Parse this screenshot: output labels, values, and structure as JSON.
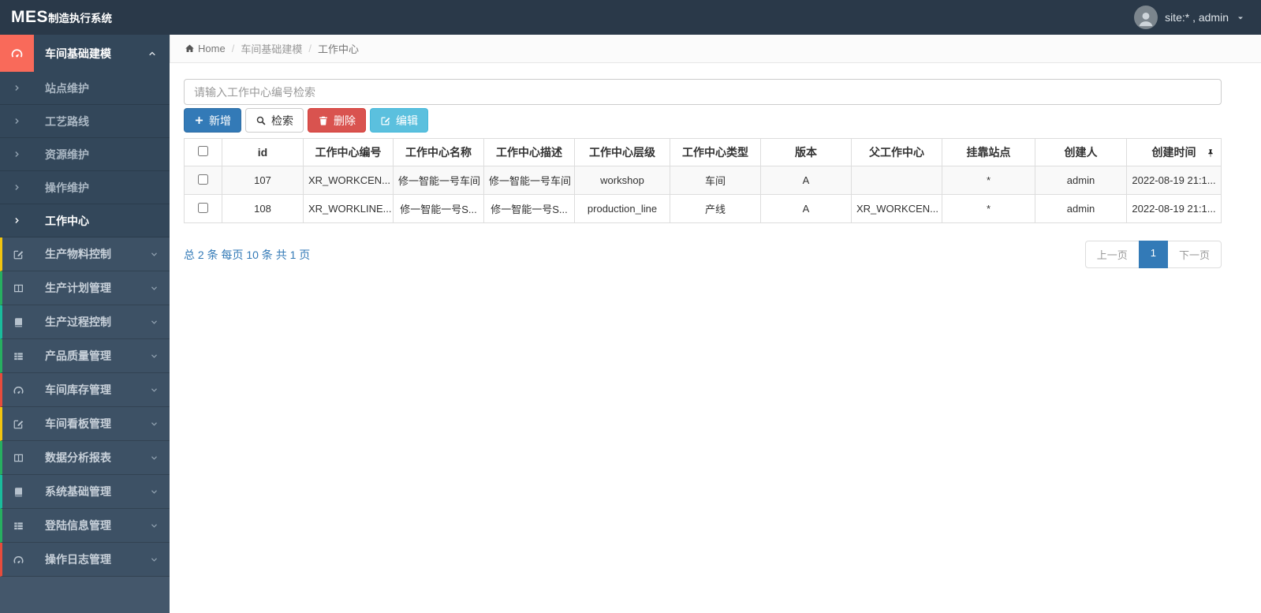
{
  "colors": {
    "topbar_bg": "#2a3949",
    "sidebar_bg": "#44576b",
    "sidebar_item_bg": "#3d5165",
    "sidebar_submenu_bg": "#33475a",
    "active_group_icon_bg": "#f96a5a",
    "primary": "#337ab7",
    "danger": "#d9534f",
    "info": "#5bc0de"
  },
  "topbar": {
    "logo_main": "MES",
    "logo_sub": "制造执行系统",
    "user": "site:* , admin",
    "user_icons": [
      "avatar",
      "caret-down-icon"
    ]
  },
  "sidebar": {
    "active_group": {
      "label": "车间基础建模",
      "icon": "gauge-icon",
      "state": "expanded"
    },
    "submenu": [
      {
        "label": "站点维护",
        "icon": "chevron-right-icon",
        "active": false
      },
      {
        "label": "工艺路线",
        "icon": "chevron-right-icon",
        "active": false
      },
      {
        "label": "资源维护",
        "icon": "chevron-right-icon",
        "active": false
      },
      {
        "label": "操作维护",
        "icon": "chevron-right-icon",
        "active": false
      },
      {
        "label": "工作中心",
        "icon": "chevron-right-icon",
        "active": true
      }
    ],
    "items": [
      {
        "label": "生产物料控制",
        "icon": "pencil-square-icon",
        "stripe": "#f1c40f"
      },
      {
        "label": "生产计划管理",
        "icon": "columns-icon",
        "stripe": "#27ae60"
      },
      {
        "label": "生产过程控制",
        "icon": "book-icon",
        "stripe": "#1abc9c"
      },
      {
        "label": "产品质量管理",
        "icon": "list-icon",
        "stripe": "#27ae60"
      },
      {
        "label": "车间库存管理",
        "icon": "gauge-icon",
        "stripe": "#e74c3c"
      },
      {
        "label": "车间看板管理",
        "icon": "pencil-square-icon",
        "stripe": "#f1c40f"
      },
      {
        "label": "数据分析报表",
        "icon": "columns-icon",
        "stripe": "#27ae60"
      },
      {
        "label": "系统基础管理",
        "icon": "book-icon",
        "stripe": "#1abc9c"
      },
      {
        "label": "登陆信息管理",
        "icon": "list-icon",
        "stripe": "#27ae60"
      },
      {
        "label": "操作日志管理",
        "icon": "gauge-icon",
        "stripe": "#e74c3c"
      }
    ]
  },
  "breadcrumb": {
    "home": "Home",
    "home_icon": "home-icon",
    "items": [
      "车间基础建模",
      "工作中心"
    ]
  },
  "main": {
    "search_placeholder": "请输入工作中心编号检索",
    "toolbar": {
      "add": {
        "label": "新增",
        "icon": "plus-icon"
      },
      "search": {
        "label": "检索",
        "icon": "search-icon"
      },
      "delete": {
        "label": "删除",
        "icon": "trash-icon"
      },
      "edit": {
        "label": "编辑",
        "icon": "edit-icon"
      }
    },
    "table": {
      "columns": [
        "id",
        "工作中心编号",
        "工作中心名称",
        "工作中心描述",
        "工作中心层级",
        "工作中心类型",
        "版本",
        "父工作中心",
        "挂靠站点",
        "创建人",
        "创建时间"
      ],
      "last_column_icon": "pin-icon",
      "rows": [
        {
          "id": "107",
          "code": "XR_WORKCEN...",
          "name": "修一智能一号车间",
          "desc": "修一智能一号车间",
          "level": "workshop",
          "type": "车间",
          "version": "A",
          "parent": "",
          "station": "*",
          "creator": "admin",
          "created": "2022-08-19 21:1..."
        },
        {
          "id": "108",
          "code": "XR_WORKLINE...",
          "name": "修一智能一号S...",
          "desc": "修一智能一号S...",
          "level": "production_line",
          "type": "产线",
          "version": "A",
          "parent": "XR_WORKCEN...",
          "station": "*",
          "creator": "admin",
          "created": "2022-08-19 21:1..."
        }
      ]
    },
    "summary": "总 2 条 每页 10 条 共 1 页",
    "pagination": {
      "prev": "上一页",
      "page": "1",
      "next": "下一页"
    }
  }
}
